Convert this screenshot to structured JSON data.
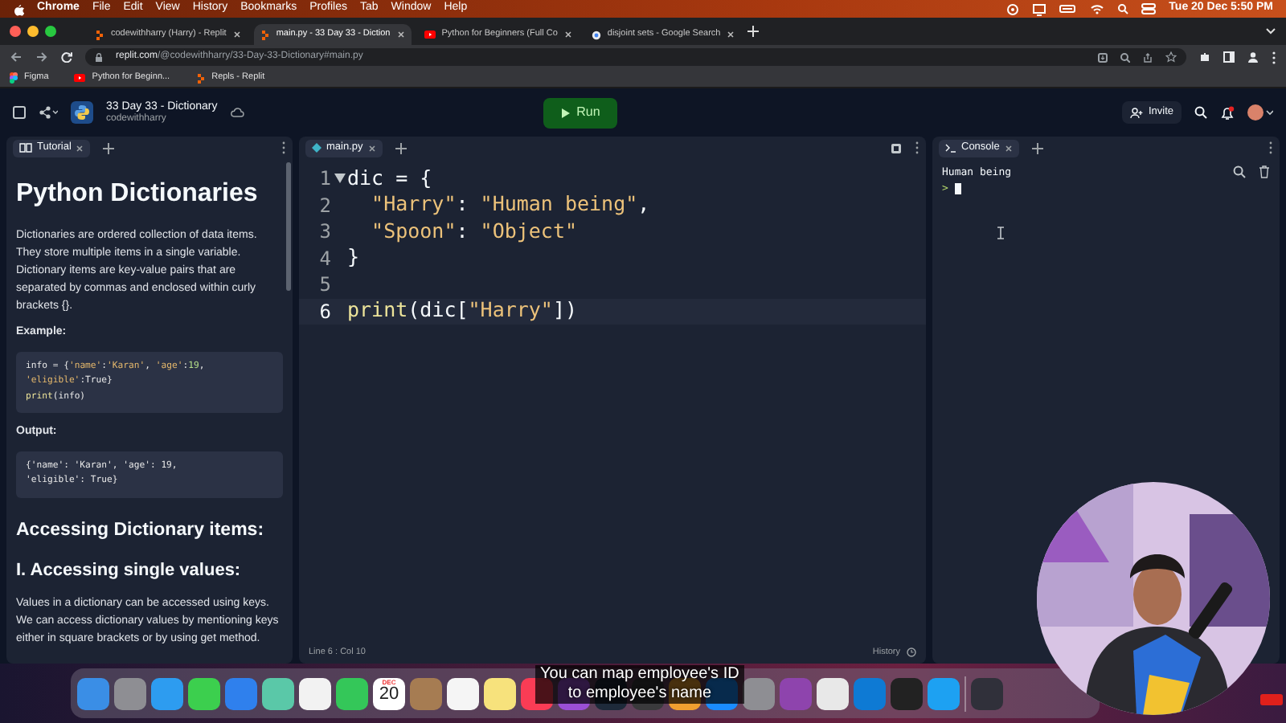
{
  "menu_bar": {
    "items": [
      {
        "label": "Chrome",
        "kind": "app"
      },
      {
        "label": "File",
        "kind": "menu"
      },
      {
        "label": "Edit",
        "kind": "menu"
      },
      {
        "label": "View",
        "kind": "menu"
      },
      {
        "label": "History",
        "kind": "menu"
      },
      {
        "label": "Bookmarks",
        "kind": "menu"
      },
      {
        "label": "Profiles",
        "kind": "menu"
      },
      {
        "label": "Tab",
        "kind": "menu"
      },
      {
        "label": "Window",
        "kind": "menu"
      },
      {
        "label": "Help",
        "kind": "menu"
      }
    ],
    "clock": "Tue 20 Dec  5:50 PM"
  },
  "browser_tabs": [
    {
      "title": "codewithharry (Harry) - Replit",
      "kind": "replit",
      "selected": false
    },
    {
      "title": "main.py - 33 Day 33 - Diction",
      "kind": "replit",
      "selected": true
    },
    {
      "title": "Python for Beginners (Full Co",
      "kind": "youtube",
      "selected": false
    },
    {
      "title": "disjoint sets - Google Search",
      "kind": "google",
      "selected": false
    }
  ],
  "address_bar": {
    "host": "replit.com",
    "path": "/@codewithharry/33-Day-33-Dictionary#main.py"
  },
  "bookmarks": [
    {
      "label": "Figma",
      "kind": "figma"
    },
    {
      "label": "Python for Beginn...",
      "kind": "youtube"
    },
    {
      "label": "Repls - Replit",
      "kind": "replit"
    }
  ],
  "repl": {
    "title": "33 Day 33 - Dictionary",
    "owner": "codewithharry",
    "run_label": "Run",
    "invite_label": "Invite",
    "notification": true
  },
  "tutorial": {
    "tab": "Tutorial",
    "blocks": [
      {
        "kind": "h1",
        "text": "Python Dictionaries"
      },
      {
        "kind": "p",
        "text": "Dictionaries are ordered collection of data items. They store multiple items in a single variable. Dictionary items are key-value pairs that are separated by commas and enclosed within curly brackets {}."
      },
      {
        "kind": "label",
        "text": "Example:"
      },
      {
        "kind": "code",
        "lines": [
          [
            {
              "kind": "plain",
              "text": "info = {"
            },
            {
              "kind": "string",
              "text": "'name'"
            },
            {
              "kind": "plain",
              "text": ":"
            },
            {
              "kind": "string",
              "text": "'Karan'"
            },
            {
              "kind": "plain",
              "text": ","
            },
            {
              "kind": "string",
              "text": " 'age'"
            },
            {
              "kind": "plain",
              "text": ":"
            },
            {
              "kind": "number",
              "text": "19"
            },
            {
              "kind": "plain",
              "text": ","
            }
          ],
          [
            {
              "kind": "string",
              "text": "'eligible'"
            },
            {
              "kind": "plain",
              "text": ":True}"
            }
          ],
          [
            {
              "kind": "func",
              "text": "print"
            },
            {
              "kind": "plain",
              "text": "(info)"
            }
          ]
        ]
      },
      {
        "kind": "label",
        "text": "Output:"
      },
      {
        "kind": "code",
        "lines": [
          [
            {
              "kind": "plain",
              "text": "{'name': 'Karan', 'age': 19,"
            }
          ],
          [
            {
              "kind": "plain",
              "text": "'eligible': True}"
            }
          ]
        ]
      },
      {
        "kind": "h2",
        "text": "Accessing Dictionary items:"
      },
      {
        "kind": "h3",
        "text": "I. Accessing single values:"
      },
      {
        "kind": "p",
        "text": "Values in a dictionary can be accessed using keys. We can access dictionary values by mentioning keys either in square brackets or by using get method."
      }
    ]
  },
  "editor": {
    "tab": "main.py",
    "lines": [
      {
        "number": "1",
        "foldable": true,
        "current": false,
        "segments": [
          {
            "kind": "plain",
            "text": "dic = {"
          }
        ]
      },
      {
        "number": "2",
        "foldable": false,
        "current": false,
        "segments": [
          {
            "kind": "string",
            "text": "  \"Harry\""
          },
          {
            "kind": "plain",
            "text": ":"
          },
          {
            "kind": "string",
            "text": " \"Human being\""
          },
          {
            "kind": "plain",
            "text": ","
          }
        ]
      },
      {
        "number": "3",
        "foldable": false,
        "current": false,
        "segments": [
          {
            "kind": "string",
            "text": "  \"Spoon\""
          },
          {
            "kind": "plain",
            "text": ":"
          },
          {
            "kind": "string",
            "text": " \"Object\""
          }
        ]
      },
      {
        "number": "4",
        "foldable": false,
        "current": false,
        "segments": [
          {
            "kind": "plain",
            "text": "}"
          }
        ]
      },
      {
        "number": "5",
        "foldable": false,
        "current": false
      },
      {
        "number": "6",
        "foldable": false,
        "current": true,
        "segments": [
          {
            "kind": "func",
            "text": "print"
          },
          {
            "kind": "plain",
            "text": "(dic["
          },
          {
            "kind": "string",
            "text": "\"Harry\""
          },
          {
            "kind": "plain",
            "text": "])"
          }
        ]
      }
    ],
    "status": "Line 6 : Col 10",
    "history_label": "History"
  },
  "console": {
    "tab": "Console",
    "output": [
      "Human being"
    ],
    "prompt": ">"
  },
  "dock": {
    "apps": [
      {
        "kind": "app",
        "color": "#3a8ee6"
      },
      {
        "kind": "app",
        "color": "#8e8e93"
      },
      {
        "kind": "app",
        "color": "#2d9cf0"
      },
      {
        "kind": "app",
        "color": "#3ccf4e"
      },
      {
        "kind": "app",
        "color": "#2f80ed"
      },
      {
        "kind": "app",
        "color": "#5ac8a8"
      },
      {
        "kind": "app",
        "color": "#f2f2f2"
      },
      {
        "kind": "app",
        "color": "#34c759"
      },
      {
        "kind": "calendar",
        "month": "DEC",
        "day": "20"
      },
      {
        "kind": "app",
        "color": "#a67c52"
      },
      {
        "kind": "app",
        "color": "#f5f5f5"
      },
      {
        "kind": "app",
        "color": "#f7e27c"
      },
      {
        "kind": "app",
        "color": "#fa3c55"
      },
      {
        "kind": "app",
        "color": "#9b4fd6"
      },
      {
        "kind": "app",
        "color": "#1e2a3a"
      },
      {
        "kind": "app",
        "color": "#3a3a3c"
      },
      {
        "kind": "app",
        "color": "#f0a030"
      },
      {
        "kind": "app",
        "color": "#1a8cff"
      },
      {
        "kind": "app",
        "color": "#8e8e93"
      },
      {
        "kind": "app",
        "color": "#8e44ad"
      },
      {
        "kind": "app",
        "color": "#e8e8e8"
      },
      {
        "kind": "app",
        "color": "#0e7ad4"
      },
      {
        "kind": "app",
        "color": "#222222"
      },
      {
        "kind": "app",
        "color": "#1da1f2"
      },
      {
        "kind": "divider"
      },
      {
        "kind": "app",
        "color": "#30303a"
      }
    ]
  },
  "caption": [
    "You can map employee's ID",
    "to employee's name"
  ],
  "webcam": {
    "kind": "picture"
  }
}
